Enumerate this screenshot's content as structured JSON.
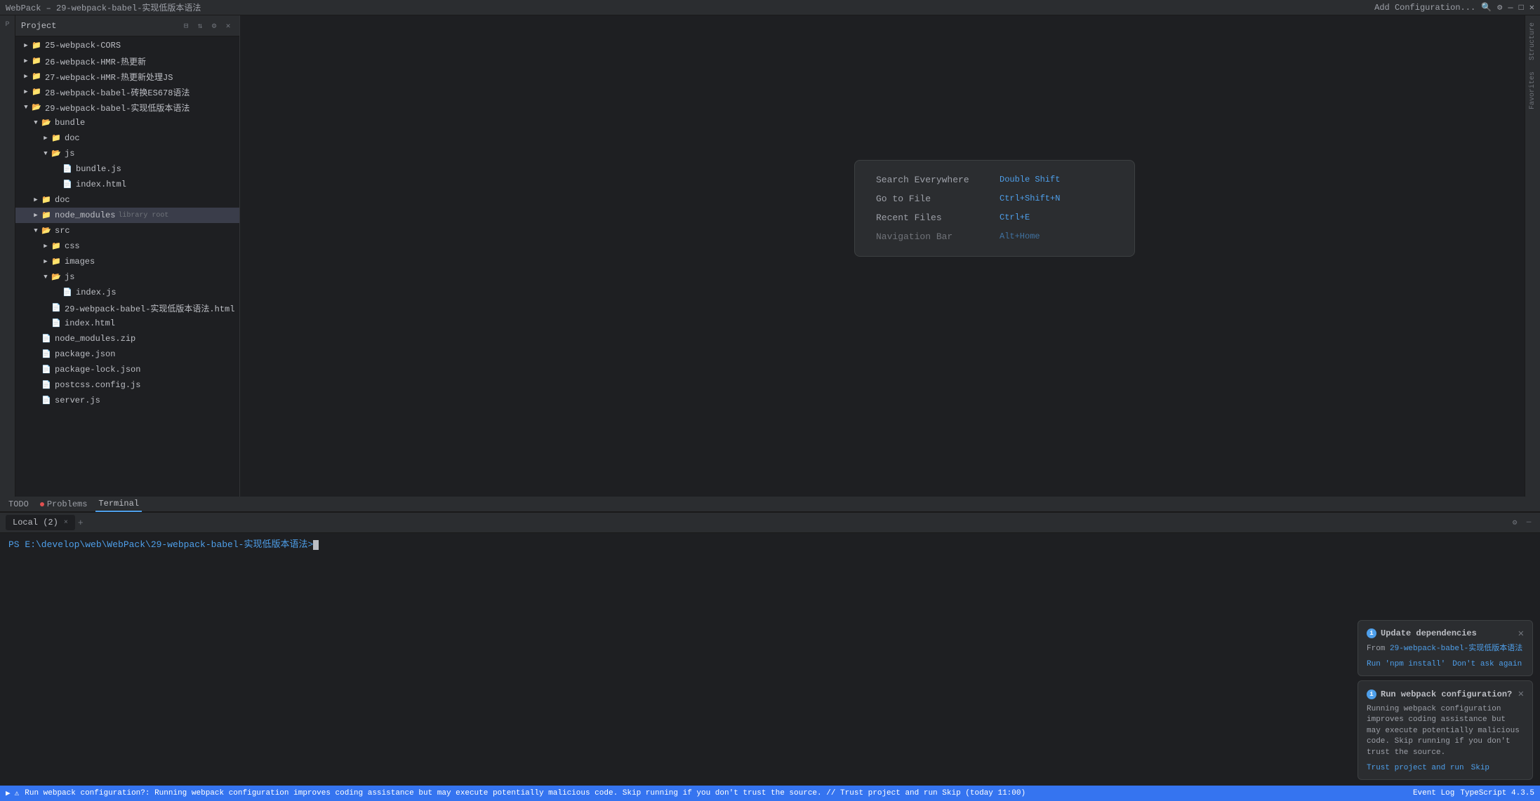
{
  "topbar": {
    "title": "WebPack – 29-webpack-babel-实现低版本语法",
    "add_config_label": "Add Configuration..."
  },
  "sidebar": {
    "project_label": "Project",
    "structure_label": "Structure",
    "favorites_label": "Favorites"
  },
  "tree": {
    "header_title": "Project",
    "items": [
      {
        "id": "25-webpack-CORS",
        "label": "25-webpack-CORS",
        "type": "folder",
        "level": 1,
        "expanded": false
      },
      {
        "id": "26-webpack-HMR",
        "label": "26-webpack-HMR-热更新",
        "type": "folder",
        "level": 1,
        "expanded": false
      },
      {
        "id": "27-webpack-HMR2",
        "label": "27-webpack-HMR-热更新处理JS",
        "type": "folder",
        "level": 1,
        "expanded": false
      },
      {
        "id": "28-webpack-babel",
        "label": "28-webpack-babel-砖换ES678语法",
        "type": "folder",
        "level": 1,
        "expanded": false
      },
      {
        "id": "29-webpack-babel",
        "label": "29-webpack-babel-实现低版本语法",
        "type": "folder",
        "level": 1,
        "expanded": true
      },
      {
        "id": "bundle",
        "label": "bundle",
        "type": "folder",
        "level": 2,
        "expanded": true
      },
      {
        "id": "doc",
        "label": "doc",
        "type": "folder",
        "level": 3,
        "expanded": false
      },
      {
        "id": "js",
        "label": "js",
        "type": "folder",
        "level": 3,
        "expanded": true
      },
      {
        "id": "bundle_js",
        "label": "bundle.js",
        "type": "file-js",
        "level": 4
      },
      {
        "id": "index_html_bundle",
        "label": "index.html",
        "type": "file-html",
        "level": 4
      },
      {
        "id": "doc2",
        "label": "doc",
        "type": "folder",
        "level": 2,
        "expanded": false
      },
      {
        "id": "node_modules",
        "label": "node_modules",
        "type": "folder",
        "level": 2,
        "expanded": false,
        "badge": "library root"
      },
      {
        "id": "src",
        "label": "src",
        "type": "folder",
        "level": 2,
        "expanded": true
      },
      {
        "id": "css",
        "label": "css",
        "type": "folder",
        "level": 3,
        "expanded": false
      },
      {
        "id": "images",
        "label": "images",
        "type": "folder",
        "level": 3,
        "expanded": false
      },
      {
        "id": "js2",
        "label": "js",
        "type": "folder",
        "level": 3,
        "expanded": true
      },
      {
        "id": "index_js",
        "label": "index.js",
        "type": "file-js",
        "level": 4
      },
      {
        "id": "29_html",
        "label": "29-webpack-babel-实现低版本语法.html",
        "type": "file-html",
        "level": 3
      },
      {
        "id": "index_html_src",
        "label": "index.html",
        "type": "file-html",
        "level": 3
      },
      {
        "id": "node_modules_zip",
        "label": "node_modules.zip",
        "type": "file-zip",
        "level": 2
      },
      {
        "id": "package_json",
        "label": "package.json",
        "type": "file-json",
        "level": 2
      },
      {
        "id": "package_lock_json",
        "label": "package-lock.json",
        "type": "file-json",
        "level": 2
      },
      {
        "id": "postcss_config",
        "label": "postcss.config.js",
        "type": "file-js",
        "level": 2
      },
      {
        "id": "server_js",
        "label": "server.js",
        "type": "file-js",
        "level": 2
      }
    ]
  },
  "search_popup": {
    "items": [
      {
        "label": "Search Everywhere",
        "shortcut": "Double Shift"
      },
      {
        "label": "Go to File",
        "shortcut": "Ctrl+Shift+N"
      },
      {
        "label": "Recent Files",
        "shortcut": "Ctrl+E"
      },
      {
        "label": "Navigation Bar",
        "shortcut": "Alt+Home"
      }
    ]
  },
  "terminal": {
    "tabs": [
      {
        "label": "TODO",
        "active": false,
        "dot_color": ""
      },
      {
        "label": "Problems",
        "active": false,
        "dot_color": "dot-red"
      },
      {
        "label": "Terminal",
        "active": true
      }
    ],
    "active_tab": "Local (2)",
    "close_label": "×",
    "add_label": "+",
    "prompt": "PS E:\\develop\\web\\WebPack\\29-webpack-babel-实现低版本语法>"
  },
  "notifications": [
    {
      "id": "update-deps",
      "title": "Update dependencies",
      "body_prefix": "From ",
      "body_link": "29-webpack-babel-实现低版本语法",
      "actions": [
        "Run 'npm install'",
        "Don't ask again"
      ]
    },
    {
      "id": "run-webpack",
      "title": "Run webpack configuration?",
      "body": "Running webpack configuration improves coding assistance but may execute potentially malicious code. Skip running if you don't trust the source.",
      "actions": [
        "Trust project and run",
        "Skip"
      ]
    }
  ],
  "status_bar": {
    "icons": [
      "⚙",
      "⚡"
    ],
    "message": "Run webpack configuration?: Running webpack configuration improves coding assistance but may execute potentially malicious code. Skip running if you don't trust the source. // Trust project and run   Skip (today 11:00)",
    "event_log": "Event Log",
    "typescript": "TypeScript 4.3.5"
  },
  "right_sidebar": {
    "labels": [
      "Structure",
      "Favorites"
    ]
  }
}
